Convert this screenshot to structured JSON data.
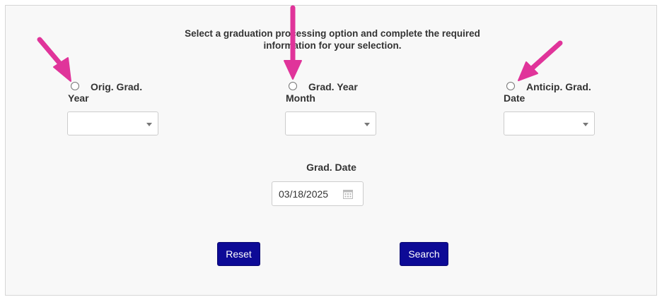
{
  "instructions": "Select a graduation processing option and complete the required information for your selection.",
  "options": [
    {
      "label": "Orig. Grad. Year",
      "selected": false,
      "dropdown_value": ""
    },
    {
      "label": "Grad. Year Month",
      "selected": false,
      "dropdown_value": ""
    },
    {
      "label": "Anticip. Grad. Date",
      "selected": false,
      "dropdown_value": ""
    }
  ],
  "grad_date": {
    "label": "Grad. Date",
    "value": "03/18/2025",
    "icon": "calendar-icon"
  },
  "buttons": {
    "reset": "Reset",
    "search": "Search"
  },
  "annotation": {
    "arrow_color": "#e0349a",
    "arrow_count": 3
  },
  "colors": {
    "button_bg": "#0d0a96",
    "panel_bg": "#f8f8f8"
  }
}
